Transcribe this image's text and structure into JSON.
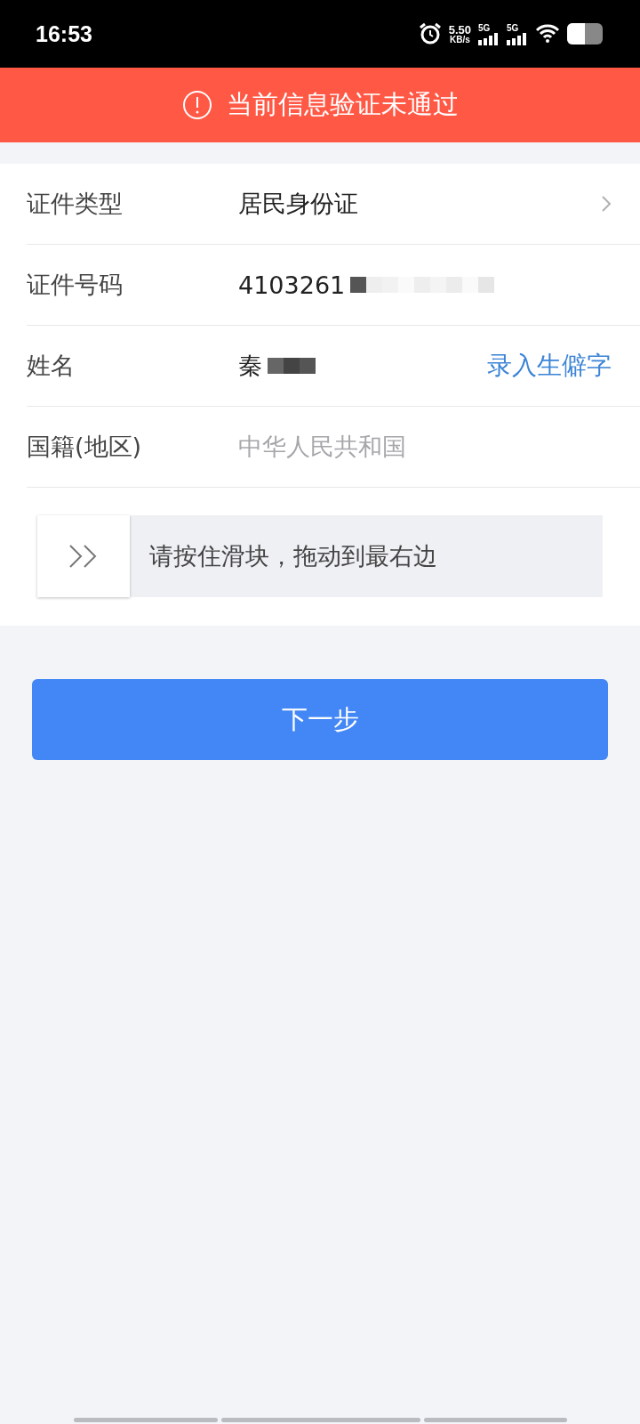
{
  "status_bar": {
    "time": "16:53",
    "net_speed": "5.50",
    "net_unit": "KB/s",
    "sim_1": "5G",
    "sim_2": "5G"
  },
  "alert": {
    "text": "当前信息验证未通过"
  },
  "form": {
    "rows": [
      {
        "kind": "select",
        "label": "证件类型",
        "value": "居民身份证"
      },
      {
        "kind": "masked",
        "label": "证件号码",
        "value": "4103261"
      },
      {
        "kind": "action",
        "label": "姓名",
        "value": "秦",
        "action": "录入生僻字"
      },
      {
        "kind": "plain",
        "label": "国籍(地区)",
        "value": "中华人民共和国"
      }
    ],
    "slider": {
      "hint": "请按住滑块，拖动到最右边",
      "level": 0
    }
  },
  "next_button": "下一步"
}
